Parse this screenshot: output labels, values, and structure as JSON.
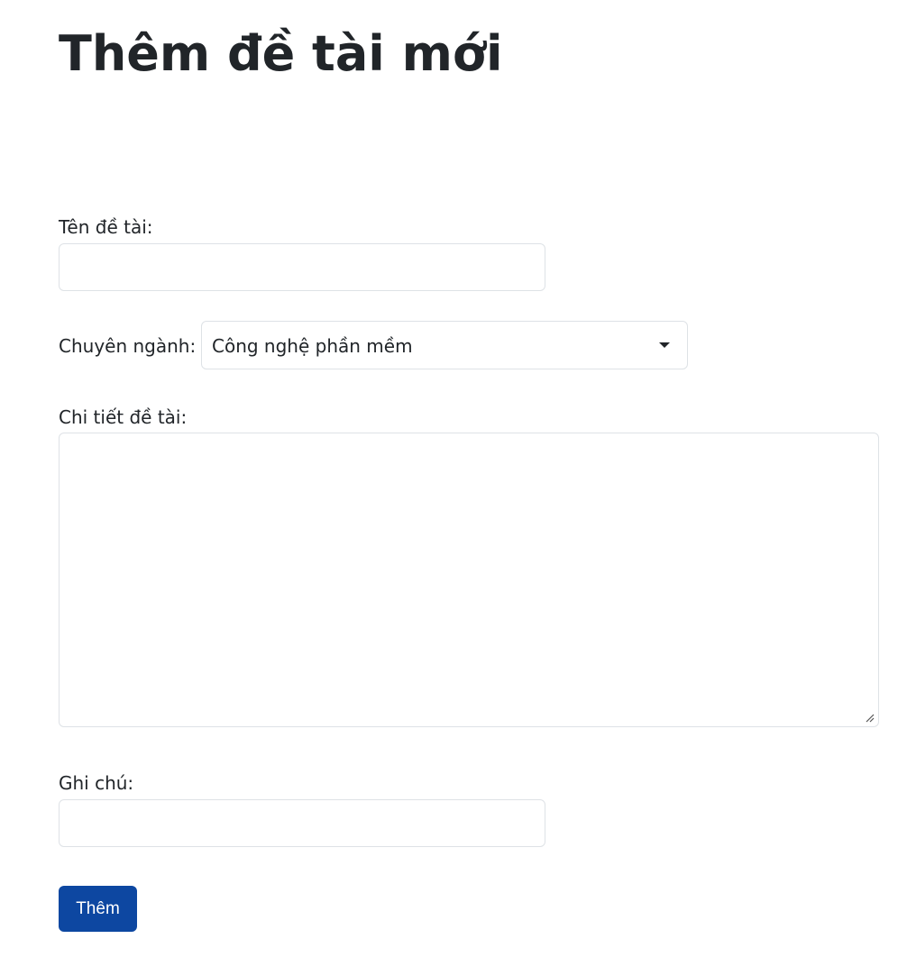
{
  "page": {
    "title": "Thêm đề tài mới"
  },
  "form": {
    "topic_name": {
      "label": "Tên đề tài:",
      "value": ""
    },
    "major": {
      "label": "Chuyên ngành:",
      "selected": "Công nghệ phần mềm",
      "icon": "chevron-down-icon"
    },
    "details": {
      "label": "Chi tiết đề tài:",
      "value": ""
    },
    "note": {
      "label": "Ghi chú:",
      "value": ""
    },
    "submit_label": "Thêm"
  },
  "colors": {
    "text": "#212529",
    "border": "#dee2e6",
    "button": "#0d47a1",
    "button_text": "#ffffff"
  }
}
